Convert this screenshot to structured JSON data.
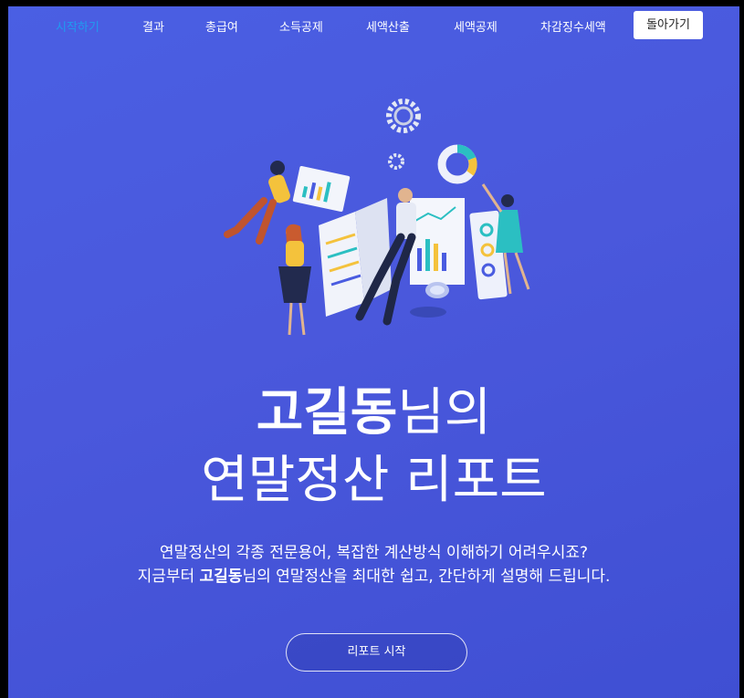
{
  "nav": {
    "items": [
      {
        "label": "시작하기",
        "active": true
      },
      {
        "label": "결과"
      },
      {
        "label": "총급여"
      },
      {
        "label": "소득공제"
      },
      {
        "label": "세액산출"
      },
      {
        "label": "세액공제"
      },
      {
        "label": "차감징수세액"
      }
    ],
    "back_label": "돌아가기"
  },
  "hero": {
    "name": "고길동",
    "title_suffix": "님의",
    "title_line2": "연말정산 리포트",
    "desc_line1": "연말정산의 각종 전문용어, 복잡한 계산방식 이해하기 어려우시죠?",
    "desc_line2_prefix": "지금부터 ",
    "desc_line2_name": "고길동",
    "desc_line2_suffix": "님의 연말정산을 최대한 쉽고, 간단하게 설명해 드립니다.",
    "start_label": "리포트 시작"
  },
  "colors": {
    "background": "#4a5ce0",
    "active_nav": "#1f9cf0",
    "accent_yellow": "#f4c23c",
    "accent_teal": "#2bbfc2"
  },
  "icons": [
    "gear-icon",
    "donut-chart-icon",
    "bar-chart-icon"
  ]
}
